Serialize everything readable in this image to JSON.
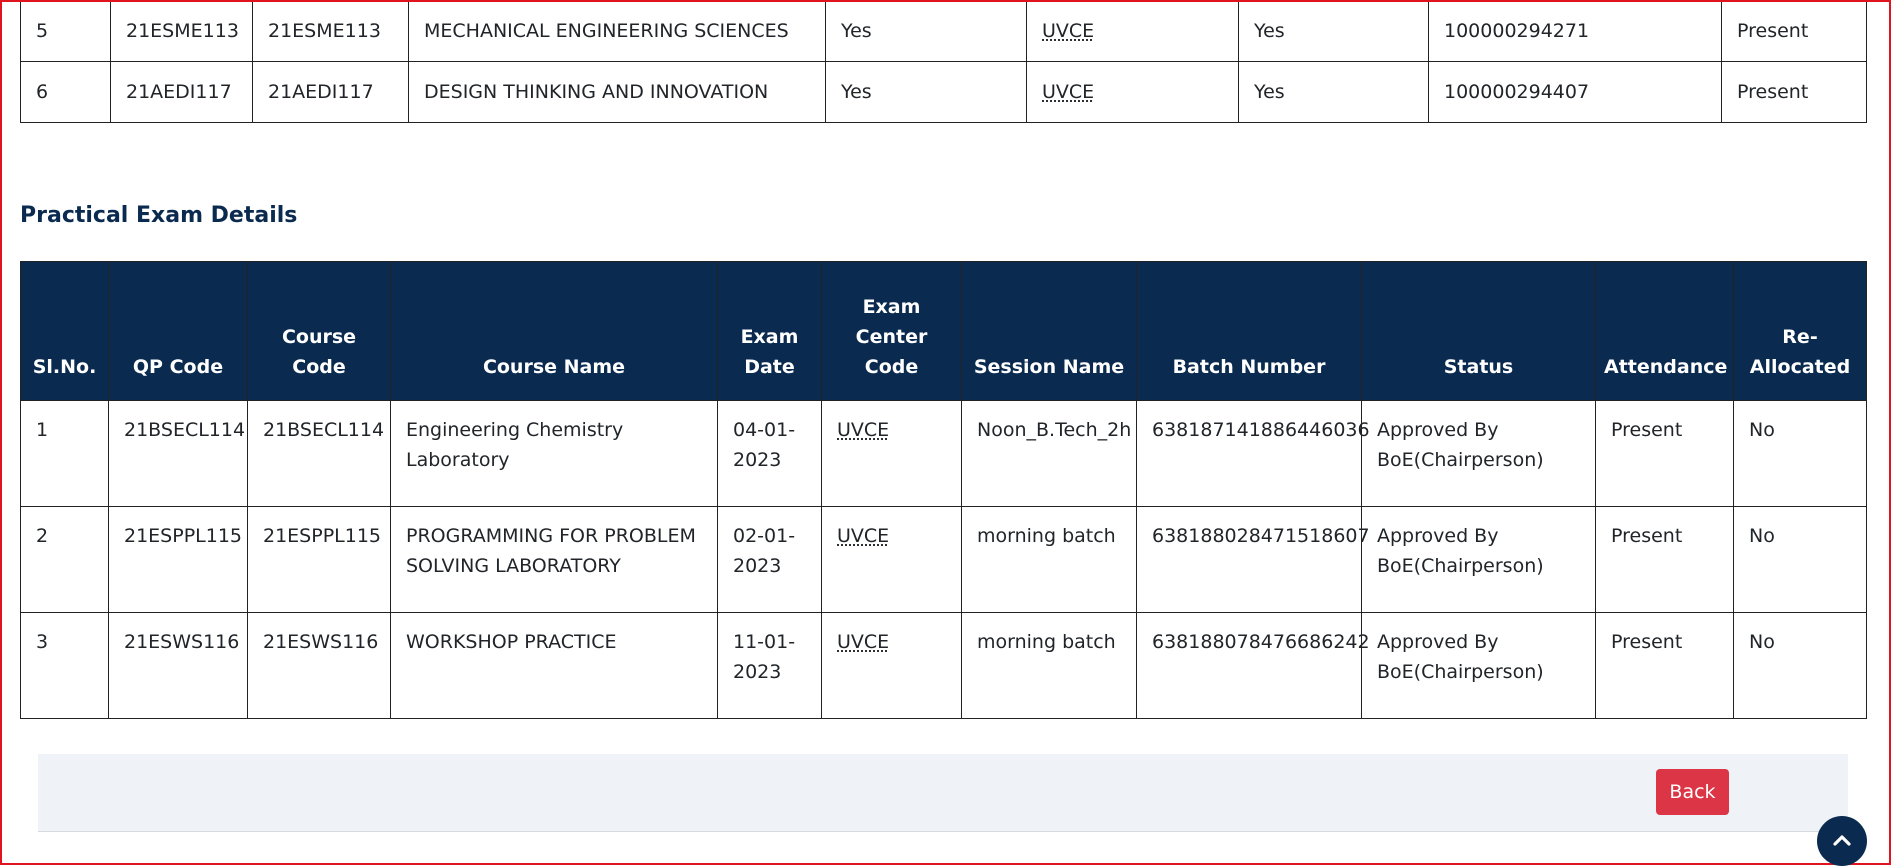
{
  "theory_rows": [
    {
      "sl": "5",
      "qp": "21ESME113",
      "code": "21ESME113",
      "name": "MECHANICAL ENGINEERING SCIENCES",
      "eligible": "Yes",
      "center": "UVCE",
      "fee": "Yes",
      "usn": "100000294271",
      "attendance": "Present"
    },
    {
      "sl": "6",
      "qp": "21AEDI117",
      "code": "21AEDI117",
      "name": "DESIGN THINKING AND INNOVATION",
      "eligible": "Yes",
      "center": "UVCE",
      "fee": "Yes",
      "usn": "100000294407",
      "attendance": "Present"
    }
  ],
  "practical": {
    "title": "Practical Exam Details",
    "headers": {
      "sl": "Sl.No.",
      "qp": "QP Code",
      "code": "Course Code",
      "name": "Course Name",
      "date": "Exam Date",
      "center": "Exam Center Code",
      "session": "Session Name",
      "batch": "Batch Number",
      "status": "Status",
      "attendance": "Attendance",
      "realloc": "Re-Allocated"
    },
    "rows": [
      {
        "sl": "1",
        "qp": "21BSECL114",
        "code": "21BSECL114",
        "name": "Engineering Chemistry Laboratory",
        "date": "04-01-2023",
        "center": "UVCE",
        "session": "Noon_B.Tech_2h",
        "batch": "638187141886446036",
        "status": "Approved By BoE(Chairperson)",
        "attendance": "Present",
        "realloc": "No"
      },
      {
        "sl": "2",
        "qp": "21ESPPL115",
        "code": "21ESPPL115",
        "name": "PROGRAMMING FOR PROBLEM SOLVING LABORATORY",
        "date": "02-01-2023",
        "center": "UVCE",
        "session": "morning batch",
        "batch": "638188028471518607",
        "status": "Approved By BoE(Chairperson)",
        "attendance": "Present",
        "realloc": "No"
      },
      {
        "sl": "3",
        "qp": "21ESWS116",
        "code": "21ESWS116",
        "name": "WORKSHOP PRACTICE",
        "date": "11-01-2023",
        "center": "UVCE",
        "session": "morning batch",
        "batch": "638188078476686242",
        "status": "Approved By BoE(Chairperson)",
        "attendance": "Present",
        "realloc": "No"
      }
    ]
  },
  "footer": {
    "back_label": "Back"
  },
  "scroll_top": {
    "icon": "chevron-up-icon"
  },
  "colors": {
    "header_bg": "#0b2a4f",
    "back_button": "#dc3545",
    "frame": "#e0141e"
  }
}
